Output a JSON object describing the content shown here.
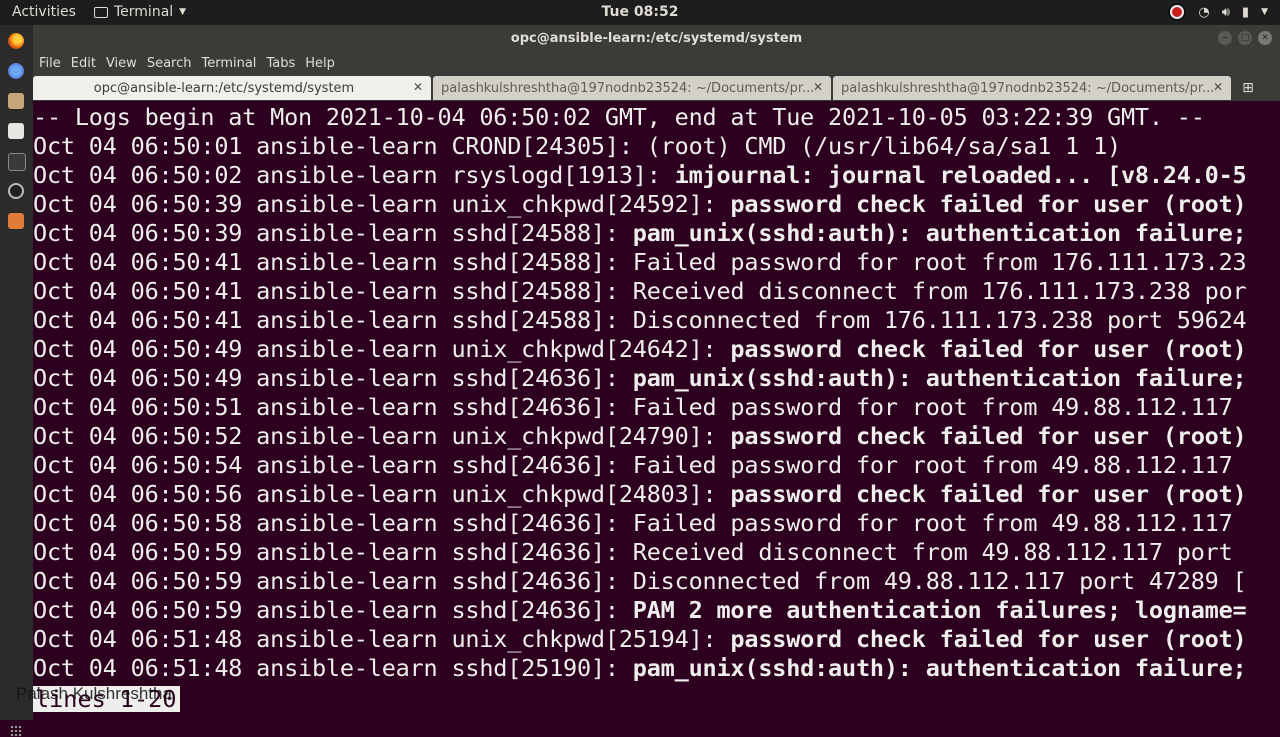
{
  "topbar": {
    "activities": "Activities",
    "app_menu": "Terminal",
    "clock": "Tue 08:52"
  },
  "window": {
    "title": "opc@ansible-learn:/etc/systemd/system"
  },
  "menubar": [
    "File",
    "Edit",
    "View",
    "Search",
    "Terminal",
    "Tabs",
    "Help"
  ],
  "tabs": [
    {
      "label": "opc@ansible-learn:/etc/systemd/system",
      "active": true
    },
    {
      "label": "palashkulshreshtha@197nodnb23524: ~/Documents/pr...",
      "active": false
    },
    {
      "label": "palashkulshreshtha@197nodnb23524: ~/Documents/pr...",
      "active": false
    }
  ],
  "terminal": {
    "lines": [
      {
        "prefix": "-- Logs begin at Mon 2021-10-04 06:50:02 GMT, end at Tue 2021-10-05 03:22:39 GMT. --",
        "msg": "",
        "bold": false
      },
      {
        "prefix": "Oct 04 06:50:01 ansible-learn CROND[24305]: ",
        "msg": "(root) CMD (/usr/lib64/sa/sa1 1 1)",
        "bold": false
      },
      {
        "prefix": "Oct 04 06:50:02 ansible-learn rsyslogd[1913]: ",
        "msg": "imjournal: journal reloaded... [v8.24.0-5",
        "bold": true
      },
      {
        "prefix": "Oct 04 06:50:39 ansible-learn unix_chkpwd[24592]: ",
        "msg": "password check failed for user (root)",
        "bold": true
      },
      {
        "prefix": "Oct 04 06:50:39 ansible-learn sshd[24588]: ",
        "msg": "pam_unix(sshd:auth): authentication failure;",
        "bold": true
      },
      {
        "prefix": "Oct 04 06:50:41 ansible-learn sshd[24588]: ",
        "msg": "Failed password for root from 176.111.173.23",
        "bold": false
      },
      {
        "prefix": "Oct 04 06:50:41 ansible-learn sshd[24588]: ",
        "msg": "Received disconnect from 176.111.173.238 por",
        "bold": false
      },
      {
        "prefix": "Oct 04 06:50:41 ansible-learn sshd[24588]: ",
        "msg": "Disconnected from 176.111.173.238 port 59624",
        "bold": false
      },
      {
        "prefix": "Oct 04 06:50:49 ansible-learn unix_chkpwd[24642]: ",
        "msg": "password check failed for user (root)",
        "bold": true
      },
      {
        "prefix": "Oct 04 06:50:49 ansible-learn sshd[24636]: ",
        "msg": "pam_unix(sshd:auth): authentication failure;",
        "bold": true
      },
      {
        "prefix": "Oct 04 06:50:51 ansible-learn sshd[24636]: ",
        "msg": "Failed password for root from 49.88.112.117",
        "bold": false
      },
      {
        "prefix": "Oct 04 06:50:52 ansible-learn unix_chkpwd[24790]: ",
        "msg": "password check failed for user (root)",
        "bold": true
      },
      {
        "prefix": "Oct 04 06:50:54 ansible-learn sshd[24636]: ",
        "msg": "Failed password for root from 49.88.112.117",
        "bold": false
      },
      {
        "prefix": "Oct 04 06:50:56 ansible-learn unix_chkpwd[24803]: ",
        "msg": "password check failed for user (root)",
        "bold": true
      },
      {
        "prefix": "Oct 04 06:50:58 ansible-learn sshd[24636]: ",
        "msg": "Failed password for root from 49.88.112.117",
        "bold": false
      },
      {
        "prefix": "Oct 04 06:50:59 ansible-learn sshd[24636]: ",
        "msg": "Received disconnect from 49.88.112.117 port",
        "bold": false
      },
      {
        "prefix": "Oct 04 06:50:59 ansible-learn sshd[24636]: ",
        "msg": "Disconnected from 49.88.112.117 port 47289 [",
        "bold": false
      },
      {
        "prefix": "Oct 04 06:50:59 ansible-learn sshd[24636]: ",
        "msg": "PAM 2 more authentication failures; logname=",
        "bold": true
      },
      {
        "prefix": "Oct 04 06:51:48 ansible-learn unix_chkpwd[25194]: ",
        "msg": "password check failed for user (root)",
        "bold": true
      },
      {
        "prefix": "Oct 04 06:51:48 ansible-learn sshd[25190]: ",
        "msg": "pam_unix(sshd:auth): authentication failure;",
        "bold": true
      }
    ],
    "pager_status": "lines 1-20"
  },
  "watermark": "Palash Kulshreshtha",
  "colors": {
    "terminal_bg": "#2c001e",
    "terminal_fg": "#eeeeec",
    "topbar_bg": "#1d1d1d",
    "titlebar_bg": "#3b3b37"
  },
  "dock_icons": [
    "firefox-icon",
    "thunderbird-icon",
    "files-icon",
    "text-editor-icon",
    "terminal-icon",
    "obs-icon",
    "image-viewer-icon"
  ]
}
